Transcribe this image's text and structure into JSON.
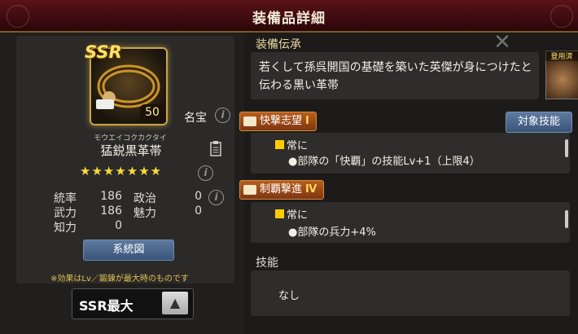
{
  "window": {
    "title": "装備品詳細"
  },
  "item": {
    "rarity": "SSR",
    "level": "50",
    "furigana": "モウエイコクカクタイ",
    "name": "猛鋭黒革帯",
    "tag": "名宝",
    "stars": "★★★★★★★",
    "stats": [
      {
        "label": "統率",
        "value": "186"
      },
      {
        "label": "武力",
        "value": "186"
      },
      {
        "label": "知力",
        "value": "0"
      },
      {
        "label": "政治",
        "value": "0"
      },
      {
        "label": "魅力",
        "value": "0"
      }
    ],
    "genealogy_button": "系統図",
    "note": "※効果はLv／鍛錬が最大時のものです",
    "selector_value": "SSR最大"
  },
  "lore": {
    "heading": "装備伝承",
    "text": "若くして孫呉開国の基礎を築いた英傑が身につけたと伝わる黒い革帯",
    "portrait_label": "登用済"
  },
  "skills": [
    {
      "name": "快撃志望",
      "rank": "Ⅰ",
      "condition": "常に",
      "effect": "●部隊の「快覇」の技能Lv+1（上限4）"
    },
    {
      "name": "制覇撃進",
      "rank": "Ⅳ",
      "condition": "常に",
      "effect": "●部隊の兵力+4%"
    }
  ],
  "target_skill_button": "対象技能",
  "technique": {
    "heading": "技能",
    "value": "なし"
  },
  "icons": {
    "info": "info-icon",
    "clipboard": "clipboard-icon",
    "close": "close-icon",
    "arrow_up": "arrow-up-icon",
    "book": "book-icon"
  }
}
